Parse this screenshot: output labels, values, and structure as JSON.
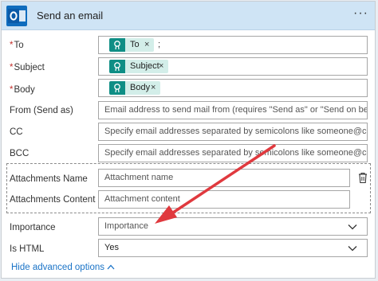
{
  "header": {
    "title": "Send an email",
    "more": "···"
  },
  "fields": {
    "to": {
      "label": "To",
      "required": "*",
      "token": "To",
      "separator": ";"
    },
    "subject": {
      "label": "Subject",
      "required": "*",
      "token": "Subject"
    },
    "body": {
      "label": "Body",
      "required": "*",
      "token": "Body"
    },
    "from": {
      "label": "From (Send as)",
      "placeholder": "Email address to send mail from (requires \"Send as\" or \"Send on behalf of\" pe"
    },
    "cc": {
      "label": "CC",
      "placeholder": "Specify email addresses separated by semicolons like someone@contoso.com"
    },
    "bcc": {
      "label": "BCC",
      "placeholder": "Specify email addresses separated by semicolons like someone@contoso.com"
    },
    "attachments_name": {
      "label": "Attachments Name",
      "placeholder": "Attachment name"
    },
    "attachments_content": {
      "label": "Attachments Content",
      "placeholder": "Attachment content"
    },
    "importance": {
      "label": "Importance",
      "value": "Importance"
    },
    "is_html": {
      "label": "Is HTML",
      "value": "Yes"
    }
  },
  "footer": {
    "hide_advanced": "Hide advanced options"
  },
  "colors": {
    "header_bg": "#cfe4f5",
    "token_bg": "#d3eee9",
    "token_icon": "#0f8e85",
    "link": "#1a73c7",
    "required": "#c4302b",
    "arrow": "#e0393e"
  },
  "icons": {
    "app": "outlook-icon",
    "token": "dynamic-content-icon",
    "remove": "close-icon",
    "delete": "trash-icon",
    "dropdown": "chevron-down-icon",
    "collapse": "chevron-up-icon"
  }
}
